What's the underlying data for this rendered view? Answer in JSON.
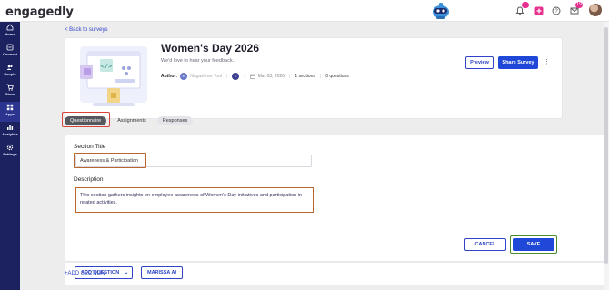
{
  "app": {
    "logo": "engagedly"
  },
  "topbar": {
    "notification_badge": "",
    "inbox_badge": "19"
  },
  "sidebar": {
    "items": [
      {
        "label": "Home",
        "icon": "home-icon"
      },
      {
        "label": "Connect",
        "icon": "connect-icon"
      },
      {
        "label": "People",
        "icon": "people-icon"
      },
      {
        "label": "Store",
        "icon": "cart-icon"
      },
      {
        "label": "Apps",
        "icon": "apps-icon",
        "active": true
      },
      {
        "label": "Analytics",
        "icon": "analytics-icon"
      },
      {
        "label": "Settings",
        "icon": "gear-icon"
      }
    ]
  },
  "nav": {
    "back_label": "< Back to surveys"
  },
  "survey": {
    "title": "Women's Day 2026",
    "subtitle": "We'd love to hear your feedback.",
    "author_label": "Author:",
    "author_initials": "M",
    "author_name": "Nagashree Tool",
    "second_initial": "E",
    "date": "Mar 03, 2026",
    "sections": "1 sections",
    "questions": "0 questions",
    "preview_label": "Preview",
    "share_label": "Share Survey"
  },
  "tabs": [
    {
      "label": "Questionnaire",
      "active": true
    },
    {
      "label": "Assignments"
    },
    {
      "label": "Responses"
    }
  ],
  "section": {
    "title_label": "Section Title",
    "title_value": "Awareness & Participation",
    "description_label": "Description",
    "description_value": "This section gathers insights on employee awareness of Women's Day initiatives and participation in related activities.",
    "cancel_label": "CANCEL",
    "save_label": "SAVE"
  },
  "actions": {
    "add_question_label": "ADD QUESTION",
    "marissa_label": "MARISSA AI",
    "add_section_label": "+ADD SECTION"
  },
  "colors": {
    "primary": "#1f47d8",
    "sidebar": "#1c2160",
    "highlight_red": "#d8433a",
    "highlight_orange": "#b9662e",
    "highlight_green": "#4c8a2f"
  }
}
